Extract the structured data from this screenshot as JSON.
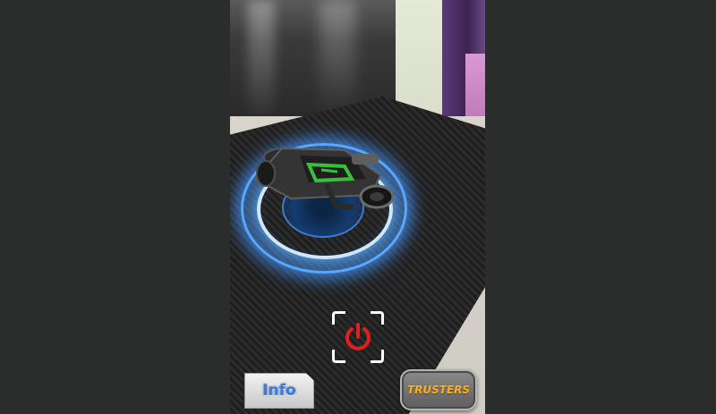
{
  "ar_view": {
    "vehicle_icon": "motorcycle",
    "power_button_icon": "power-icon",
    "accent_color": "#e02020",
    "ring_color": "#5aa9ff"
  },
  "controls": {
    "info_label": "Info",
    "trusters_label": "TRUSTERS"
  }
}
